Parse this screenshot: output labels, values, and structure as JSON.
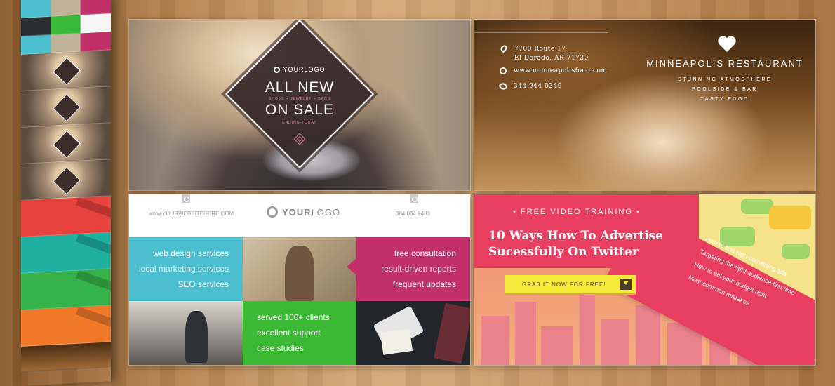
{
  "sale": {
    "logo": "YOURLOGO",
    "headline_line1": "ALL NEW",
    "headline_line2": "ON SALE",
    "categories": "SHOES + JEWELRY + BAGS",
    "ending": "ENDING TODAY"
  },
  "restaurant": {
    "address_line1": "7700 Route 17",
    "address_line2": "El Dorado, AR 71730",
    "website": "www.minneapolisfood.com",
    "phone": "344 944 0349",
    "title": "MINNEAPOLIS RESTAURANT",
    "tagline1": "STUNNING ATMOSPHERE",
    "tagline2": "POOLSIDE & BAR",
    "tagline3": "TASTY FOOD"
  },
  "business": {
    "website": "www.YOURWEBSITEHERE.COM",
    "logo_bold": "YOUR",
    "logo_light": "LOGO",
    "phone": "384 034 9483",
    "services_left": [
      "web design services",
      "local marketing services",
      "SEO services"
    ],
    "services_right": [
      "free consultation",
      "result-driven reports",
      "frequent updates"
    ],
    "services_green": [
      "served 100+ clients",
      "excellent support",
      "case studies"
    ]
  },
  "ad": {
    "kicker": "• FREE VIDEO TRAINING •",
    "title_line1": "10 Ways How To Advertise",
    "title_line2": "Sucessfully On Twitter",
    "button": "GRAB IT NOW FOR FREE!",
    "points": [
      "How to find high-converting ads",
      "Targeting the right audience first time",
      "How to set your budget right",
      "Most common mistakes"
    ]
  }
}
